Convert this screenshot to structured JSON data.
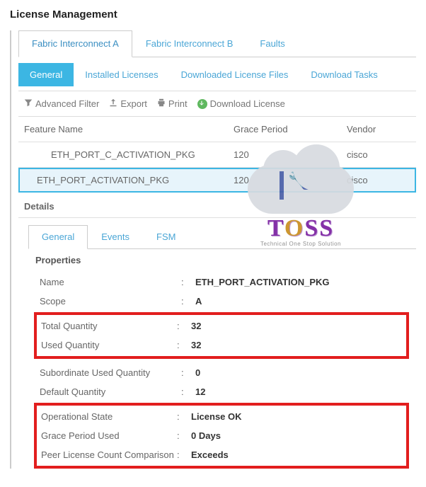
{
  "title": "License Management",
  "outerTabs": [
    "Fabric Interconnect A",
    "Fabric Interconnect B",
    "Faults"
  ],
  "subTabs": [
    "General",
    "Installed Licenses",
    "Downloaded License Files",
    "Download Tasks"
  ],
  "toolbar": {
    "advFilter": "Advanced Filter",
    "export": "Export",
    "print": "Print",
    "download": "Download License"
  },
  "table": {
    "headers": {
      "feature": "Feature Name",
      "grace": "Grace Period",
      "vendor": "Vendor"
    },
    "rows": [
      {
        "feature": "ETH_PORT_C_ACTIVATION_PKG",
        "grace": "120",
        "vendor": "cisco"
      },
      {
        "feature": "ETH_PORT_ACTIVATION_PKG",
        "grace": "120",
        "vendor": "cisco"
      }
    ]
  },
  "detailsHeader": "Details",
  "detailTabs": [
    "General",
    "Events",
    "FSM"
  ],
  "propsHeader": "Properties",
  "props": {
    "name": {
      "label": "Name",
      "value": "ETH_PORT_ACTIVATION_PKG"
    },
    "scope": {
      "label": "Scope",
      "value": "A"
    },
    "totalQty": {
      "label": "Total Quantity",
      "value": "32"
    },
    "usedQty": {
      "label": "Used Quantity",
      "value": "32"
    },
    "subUsedQty": {
      "label": "Subordinate Used Quantity",
      "value": "0"
    },
    "defaultQty": {
      "label": "Default Quantity",
      "value": "12"
    },
    "opState": {
      "label": "Operational State",
      "value": "License OK"
    },
    "gracePeriodUsed": {
      "label": "Grace Period Used",
      "value": "0 Days"
    },
    "peerCompare": {
      "label": "Peer License Count Comparison",
      "value": "Exceeds"
    }
  },
  "watermark": {
    "brand": "TOSS",
    "tagline": "Technical One Stop Solution"
  }
}
